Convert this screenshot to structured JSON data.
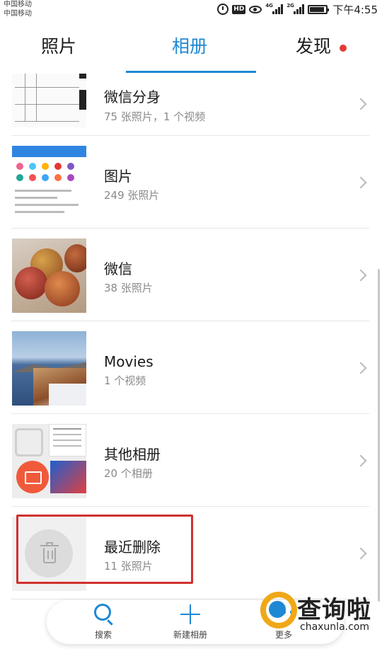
{
  "status_bar": {
    "carrier_1": "中国移动",
    "carrier_2": "中国移动",
    "hd_badge": "HD",
    "network_1": "4G",
    "network_2": "2G",
    "time": "下午4:55",
    "battery_level": 0.9,
    "icons": [
      "alarm-icon",
      "hd-icon",
      "eye-comfort-icon",
      "signal-icon",
      "signal-icon",
      "battery-icon"
    ]
  },
  "tabs": [
    {
      "label": "照片",
      "active": false
    },
    {
      "label": "相册",
      "active": true
    },
    {
      "label": "发现",
      "active": false,
      "badge_dot": true
    }
  ],
  "accent_color": "#1e88d4",
  "highlight_color": "#d0312d",
  "albums": [
    {
      "name": "微信分身",
      "count": "75 张照片，1 个视频",
      "thumb": "table-screenshot"
    },
    {
      "name": "图片",
      "count": "249 张照片",
      "thumb": "app-screenshot"
    },
    {
      "name": "微信",
      "count": "38 张照片",
      "thumb": "apples-photo"
    },
    {
      "name": "Movies",
      "count": "1 个视频",
      "thumb": "seaside-photo"
    },
    {
      "name": "其他相册",
      "count": "20 个相册",
      "thumb": "collage"
    },
    {
      "name": "最近删除",
      "count": "11 张照片",
      "thumb": "trash-icon",
      "highlighted": true
    }
  ],
  "bottom_bar": {
    "search_label": "搜索",
    "new_album_label": "新建相册",
    "more_label": "更多"
  },
  "watermark": {
    "title": "查询啦",
    "url": "chaxunla.com"
  }
}
